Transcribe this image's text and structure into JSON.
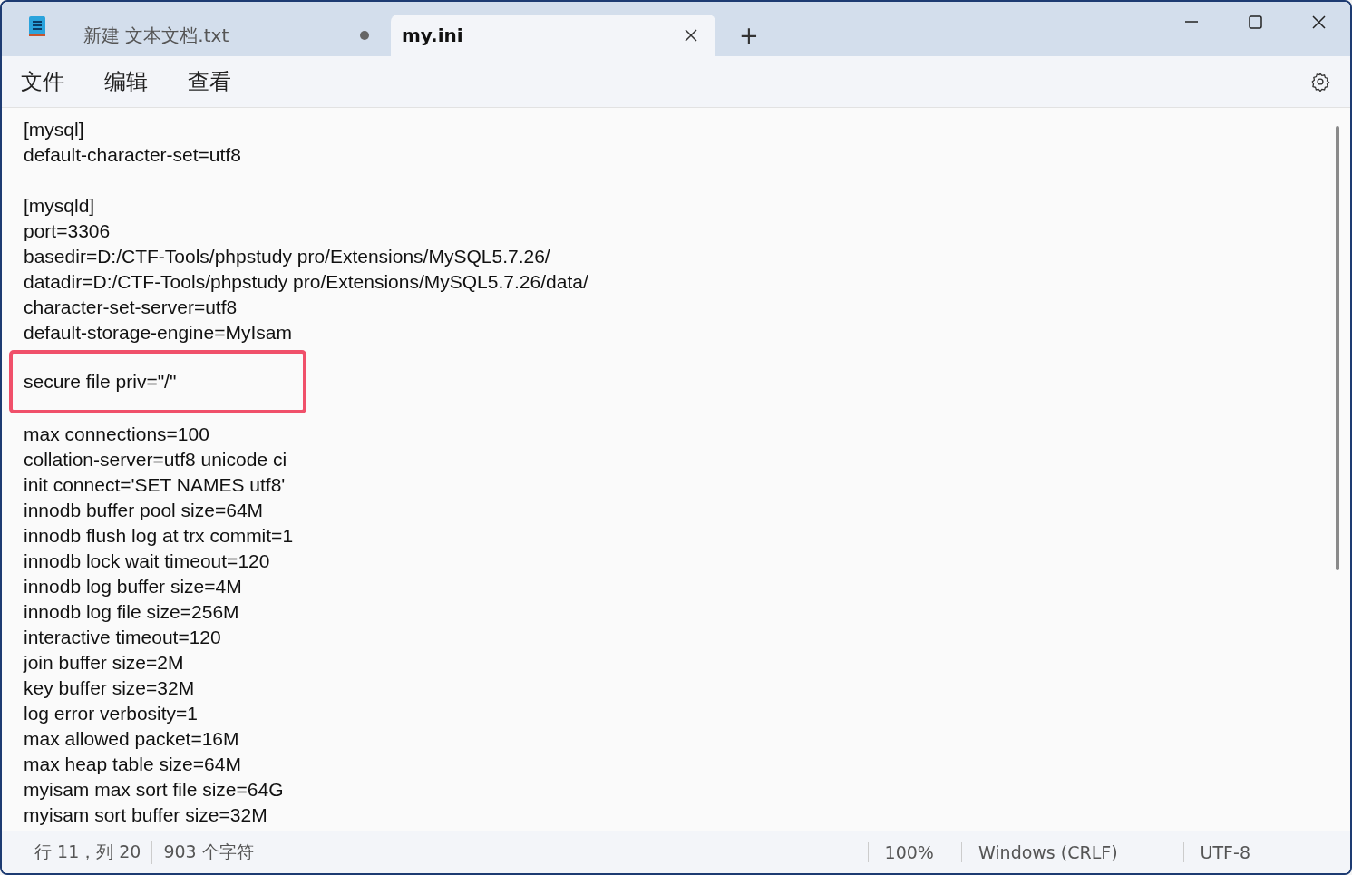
{
  "tabs": [
    {
      "label": "新建 文本文档.txt",
      "selected": false,
      "modified": true
    },
    {
      "label": "my.ini",
      "selected": true,
      "modified": false
    }
  ],
  "new_tab_button": "+",
  "menu": [
    "文件",
    "编辑",
    "查看"
  ],
  "lines": [
    {
      "kind": "text",
      "text": "[mysql]"
    },
    {
      "kind": "text",
      "text": "default-character-set=utf8"
    },
    {
      "kind": "blank"
    },
    {
      "kind": "text",
      "text": "[mysqld]"
    },
    {
      "kind": "text",
      "text": "port=3306"
    },
    {
      "kind": "text",
      "text": "basedir=D:/CTF-Tools/phpstudy pro/Extensions/MySQL5.7.26/"
    },
    {
      "kind": "text",
      "text": "datadir=D:/CTF-Tools/phpstudy pro/Extensions/MySQL5.7.26/data/"
    },
    {
      "kind": "text",
      "text": "character-set-server=utf8"
    },
    {
      "kind": "text",
      "text": "default-storage-engine=MyIsam"
    },
    {
      "kind": "highlighted",
      "text": "secure file priv=\"/\""
    },
    {
      "kind": "text",
      "text": "max connections=100"
    },
    {
      "kind": "text",
      "text": "collation-server=utf8 unicode ci"
    },
    {
      "kind": "text",
      "text": "init connect='SET NAMES utf8'"
    },
    {
      "kind": "text",
      "text": "innodb buffer pool size=64M"
    },
    {
      "kind": "text",
      "text": "innodb flush log at trx commit=1"
    },
    {
      "kind": "text",
      "text": "innodb lock wait timeout=120"
    },
    {
      "kind": "text",
      "text": "innodb log buffer size=4M"
    },
    {
      "kind": "text",
      "text": "innodb log file size=256M"
    },
    {
      "kind": "text",
      "text": "interactive timeout=120"
    },
    {
      "kind": "text",
      "text": "join buffer size=2M"
    },
    {
      "kind": "text",
      "text": "key buffer size=32M"
    },
    {
      "kind": "text",
      "text": "log error verbosity=1"
    },
    {
      "kind": "text",
      "text": "max allowed packet=16M"
    },
    {
      "kind": "text",
      "text": "max heap table size=64M"
    },
    {
      "kind": "text",
      "text": "myisam max sort file size=64G"
    },
    {
      "kind": "text",
      "text": "myisam sort buffer size=32M"
    }
  ],
  "status_bar": {
    "position": "行 11，列 20",
    "characters": "903 个字符",
    "zoom": "100%",
    "line_ending": "Windows (CRLF)",
    "encoding": "UTF-8"
  }
}
